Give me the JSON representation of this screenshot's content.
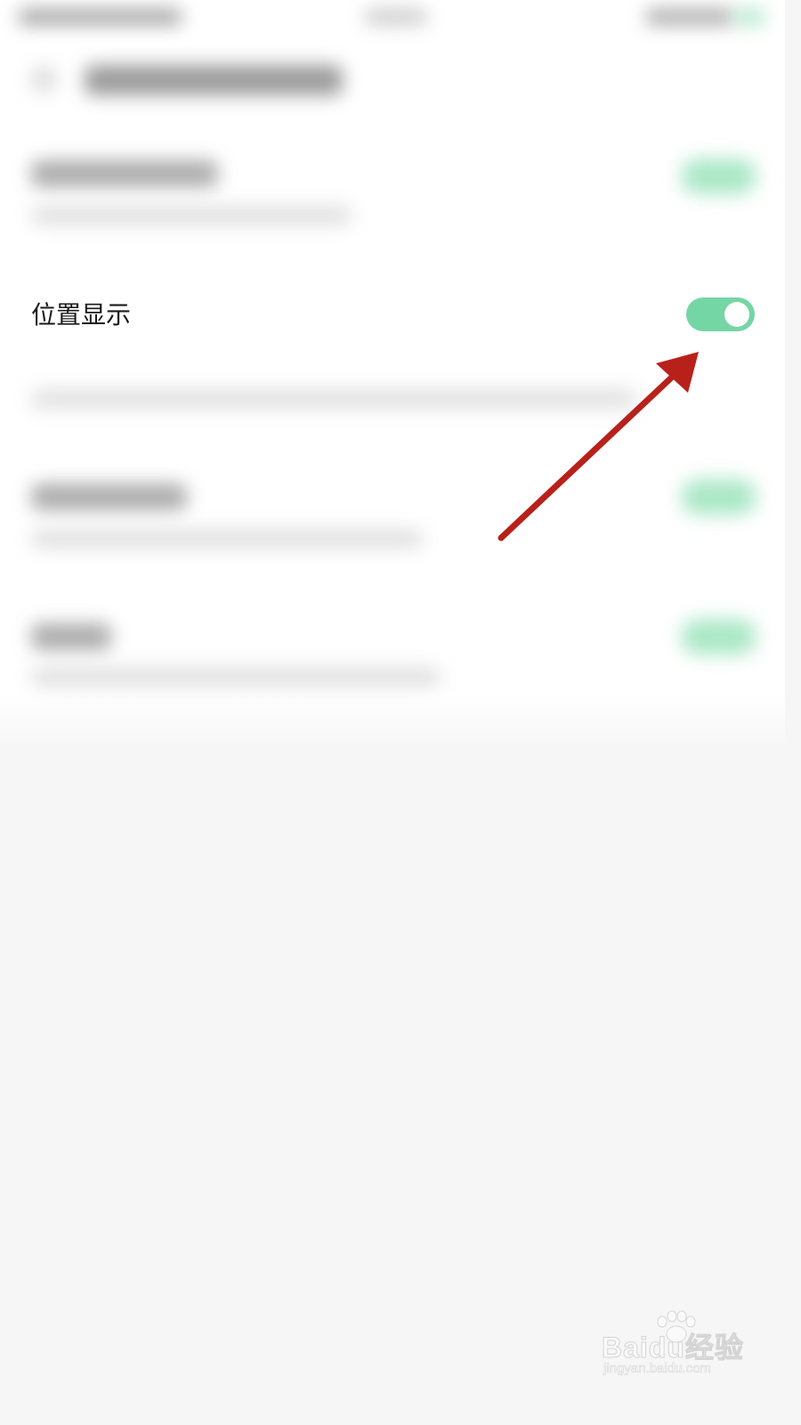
{
  "setting": {
    "label": "位置显示",
    "enabled": true
  },
  "colors": {
    "toggle_on": "#74d6a4",
    "annotation_arrow": "#b8211a",
    "page_background": "#f6f6f6",
    "panel_background": "#ffffff"
  },
  "watermark": {
    "brand": "Baidu经验",
    "url": "jingyan.baidu.com"
  }
}
